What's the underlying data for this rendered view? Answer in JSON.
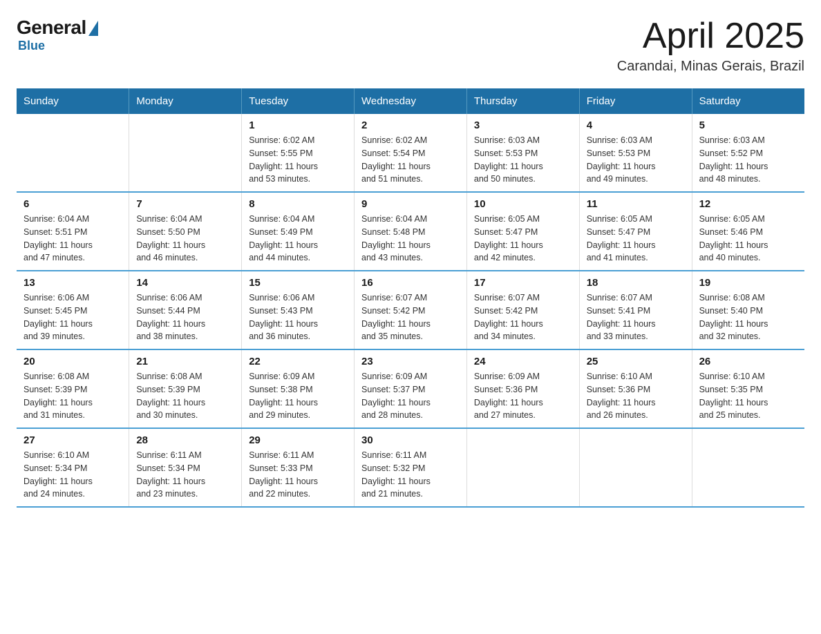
{
  "logo": {
    "general": "General",
    "blue": "Blue"
  },
  "title": {
    "month_year": "April 2025",
    "location": "Carandai, Minas Gerais, Brazil"
  },
  "headers": [
    "Sunday",
    "Monday",
    "Tuesday",
    "Wednesday",
    "Thursday",
    "Friday",
    "Saturday"
  ],
  "weeks": [
    [
      {
        "day": "",
        "info": ""
      },
      {
        "day": "",
        "info": ""
      },
      {
        "day": "1",
        "info": "Sunrise: 6:02 AM\nSunset: 5:55 PM\nDaylight: 11 hours\nand 53 minutes."
      },
      {
        "day": "2",
        "info": "Sunrise: 6:02 AM\nSunset: 5:54 PM\nDaylight: 11 hours\nand 51 minutes."
      },
      {
        "day": "3",
        "info": "Sunrise: 6:03 AM\nSunset: 5:53 PM\nDaylight: 11 hours\nand 50 minutes."
      },
      {
        "day": "4",
        "info": "Sunrise: 6:03 AM\nSunset: 5:53 PM\nDaylight: 11 hours\nand 49 minutes."
      },
      {
        "day": "5",
        "info": "Sunrise: 6:03 AM\nSunset: 5:52 PM\nDaylight: 11 hours\nand 48 minutes."
      }
    ],
    [
      {
        "day": "6",
        "info": "Sunrise: 6:04 AM\nSunset: 5:51 PM\nDaylight: 11 hours\nand 47 minutes."
      },
      {
        "day": "7",
        "info": "Sunrise: 6:04 AM\nSunset: 5:50 PM\nDaylight: 11 hours\nand 46 minutes."
      },
      {
        "day": "8",
        "info": "Sunrise: 6:04 AM\nSunset: 5:49 PM\nDaylight: 11 hours\nand 44 minutes."
      },
      {
        "day": "9",
        "info": "Sunrise: 6:04 AM\nSunset: 5:48 PM\nDaylight: 11 hours\nand 43 minutes."
      },
      {
        "day": "10",
        "info": "Sunrise: 6:05 AM\nSunset: 5:47 PM\nDaylight: 11 hours\nand 42 minutes."
      },
      {
        "day": "11",
        "info": "Sunrise: 6:05 AM\nSunset: 5:47 PM\nDaylight: 11 hours\nand 41 minutes."
      },
      {
        "day": "12",
        "info": "Sunrise: 6:05 AM\nSunset: 5:46 PM\nDaylight: 11 hours\nand 40 minutes."
      }
    ],
    [
      {
        "day": "13",
        "info": "Sunrise: 6:06 AM\nSunset: 5:45 PM\nDaylight: 11 hours\nand 39 minutes."
      },
      {
        "day": "14",
        "info": "Sunrise: 6:06 AM\nSunset: 5:44 PM\nDaylight: 11 hours\nand 38 minutes."
      },
      {
        "day": "15",
        "info": "Sunrise: 6:06 AM\nSunset: 5:43 PM\nDaylight: 11 hours\nand 36 minutes."
      },
      {
        "day": "16",
        "info": "Sunrise: 6:07 AM\nSunset: 5:42 PM\nDaylight: 11 hours\nand 35 minutes."
      },
      {
        "day": "17",
        "info": "Sunrise: 6:07 AM\nSunset: 5:42 PM\nDaylight: 11 hours\nand 34 minutes."
      },
      {
        "day": "18",
        "info": "Sunrise: 6:07 AM\nSunset: 5:41 PM\nDaylight: 11 hours\nand 33 minutes."
      },
      {
        "day": "19",
        "info": "Sunrise: 6:08 AM\nSunset: 5:40 PM\nDaylight: 11 hours\nand 32 minutes."
      }
    ],
    [
      {
        "day": "20",
        "info": "Sunrise: 6:08 AM\nSunset: 5:39 PM\nDaylight: 11 hours\nand 31 minutes."
      },
      {
        "day": "21",
        "info": "Sunrise: 6:08 AM\nSunset: 5:39 PM\nDaylight: 11 hours\nand 30 minutes."
      },
      {
        "day": "22",
        "info": "Sunrise: 6:09 AM\nSunset: 5:38 PM\nDaylight: 11 hours\nand 29 minutes."
      },
      {
        "day": "23",
        "info": "Sunrise: 6:09 AM\nSunset: 5:37 PM\nDaylight: 11 hours\nand 28 minutes."
      },
      {
        "day": "24",
        "info": "Sunrise: 6:09 AM\nSunset: 5:36 PM\nDaylight: 11 hours\nand 27 minutes."
      },
      {
        "day": "25",
        "info": "Sunrise: 6:10 AM\nSunset: 5:36 PM\nDaylight: 11 hours\nand 26 minutes."
      },
      {
        "day": "26",
        "info": "Sunrise: 6:10 AM\nSunset: 5:35 PM\nDaylight: 11 hours\nand 25 minutes."
      }
    ],
    [
      {
        "day": "27",
        "info": "Sunrise: 6:10 AM\nSunset: 5:34 PM\nDaylight: 11 hours\nand 24 minutes."
      },
      {
        "day": "28",
        "info": "Sunrise: 6:11 AM\nSunset: 5:34 PM\nDaylight: 11 hours\nand 23 minutes."
      },
      {
        "day": "29",
        "info": "Sunrise: 6:11 AM\nSunset: 5:33 PM\nDaylight: 11 hours\nand 22 minutes."
      },
      {
        "day": "30",
        "info": "Sunrise: 6:11 AM\nSunset: 5:32 PM\nDaylight: 11 hours\nand 21 minutes."
      },
      {
        "day": "",
        "info": ""
      },
      {
        "day": "",
        "info": ""
      },
      {
        "day": "",
        "info": ""
      }
    ]
  ]
}
